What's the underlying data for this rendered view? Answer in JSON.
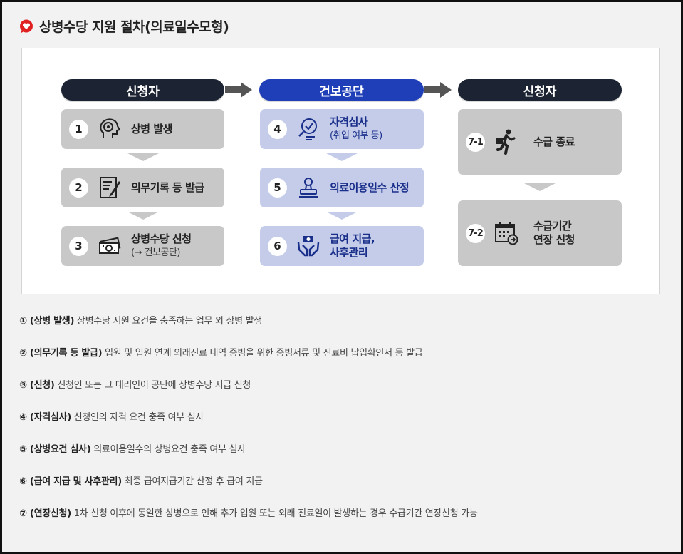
{
  "title": "상병수당 지원 절차(의료일수모형)",
  "colors": {
    "dark_header": "#1c2433",
    "blue_header": "#1f3fb8",
    "gray_box": "#c8c8c8",
    "light_blue_box": "#c4ccea",
    "title_icon": "#e02020"
  },
  "columns": [
    {
      "header": "신청자"
    },
    {
      "header": "건보공단"
    },
    {
      "header": "신청자"
    }
  ],
  "steps": [
    {
      "num": "1",
      "icon": "head-sick-icon",
      "label": "상병 발생",
      "sub": ""
    },
    {
      "num": "2",
      "icon": "document-pen-icon",
      "label": "의무기록 등 발급",
      "sub": ""
    },
    {
      "num": "3",
      "icon": "money-icon",
      "label": "상병수당 신청",
      "sub": "(→ 건보공단)"
    },
    {
      "num": "4",
      "icon": "checklist-search-icon",
      "label": "자격심사",
      "sub": "(취업 여부 등)"
    },
    {
      "num": "5",
      "icon": "stamp-icon",
      "label": "의료이용일수 산정",
      "sub": ""
    },
    {
      "num": "6",
      "icon": "hands-money-icon",
      "label": "급여 지급,",
      "label2": "사후관리",
      "sub": ""
    },
    {
      "num": "7-1",
      "icon": "walking-person-icon",
      "label": "수급 종료",
      "sub": ""
    },
    {
      "num": "7-2",
      "icon": "calendar-icon",
      "label": "수급기간",
      "label2": "연장 신청",
      "sub": ""
    }
  ],
  "notes": [
    {
      "bold": "① (상병 발생)",
      "text": " 상병수당 지원 요건을 충족하는 업무 외 상병 발생"
    },
    {
      "bold": "② (의무기록 등 발급)",
      "text": " 입원 및 입원 연계 외래진료 내역 증빙을 위한 증빙서류 및 진료비 납입확인서 등 발급"
    },
    {
      "bold": "③ (신청)",
      "text": " 신청인 또는 그 대리인이 공단에 상병수당 지급 신청"
    },
    {
      "bold": "④ (자격심사)",
      "text": " 신청인의 자격 요건 충족 여부 심사"
    },
    {
      "bold": "⑤ (상병요건 심사)",
      "text": " 의료이용일수의 상병요건 충족 여부 심사"
    },
    {
      "bold": "⑥ (급여 지급 및 사후관리)",
      "text": " 최종 급여지급기간 산정 후 급여 지급"
    },
    {
      "bold": "⑦ (연장신청)",
      "text": " 1차 신청 이후에 동일한 상병으로 인해 추가 입원 또는 외래 진료일이 발생하는 경우 수급기간 연장신청 가능"
    }
  ]
}
